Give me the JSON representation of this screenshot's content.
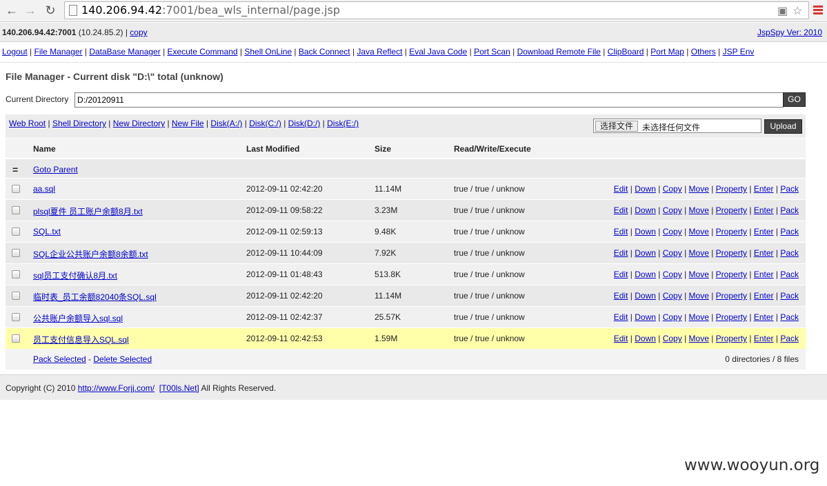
{
  "browser": {
    "url_host": "140.206.94.42",
    "url_path": ":7001/bea_wls_internal/page.jsp"
  },
  "header": {
    "host": "140.206.94.42:7001",
    "ip": " (10.24.85.2) | ",
    "copy": "copy",
    "version": "JspSpy Ver: 2010"
  },
  "nav": [
    "Logout",
    "File Manager",
    "DataBase Manager",
    "Execute Command",
    "Shell OnLine",
    "Back Connect",
    "Java Reflect",
    "Eval Java Code",
    "Port Scan",
    "Download Remote File",
    "ClipBoard",
    "Port Map",
    "Others",
    "JSP Env"
  ],
  "title": "File Manager - Current disk \"D:\\\" total (unknow)",
  "current_directory": {
    "label": "Current Directory",
    "value": "D:/20120911",
    "go": "GO"
  },
  "toolbar": {
    "links": [
      "Web Root",
      "Shell Directory",
      "New Directory",
      "New File",
      "Disk(A:/)",
      "Disk(C:/)",
      "Disk(D:/)",
      "Disk(E:/)"
    ],
    "choose_file": "选择文件",
    "no_file": "未选择任何文件",
    "upload": "Upload"
  },
  "table": {
    "headers": [
      "Name",
      "Last Modified",
      "Size",
      "Read/Write/Execute"
    ],
    "parent_icon": "=",
    "goto_parent": "Goto Parent",
    "rows": [
      {
        "name": "aa.sql",
        "modified": "2012-09-11 02:42:20",
        "size": "11.14M",
        "rwx": "true / true / unknow"
      },
      {
        "name": "plsql夏件 员工账户余额8月.txt",
        "modified": "2012-09-11 09:58:22",
        "size": "3.23M",
        "rwx": "true / true / unknow"
      },
      {
        "name": "SQL.txt",
        "modified": "2012-09-11 02:59:13",
        "size": "9.48K",
        "rwx": "true / true / unknow"
      },
      {
        "name": "SQL企业公共账户余额8余额.txt",
        "modified": "2012-09-11 10:44:09",
        "size": "7.92K",
        "rwx": "true / true / unknow"
      },
      {
        "name": "sql员工支付确认8月.txt",
        "modified": "2012-09-11 01:48:43",
        "size": "513.8K",
        "rwx": "true / true / unknow"
      },
      {
        "name": "临时表_员工余额82040条SQL.sql",
        "modified": "2012-09-11 02:42:20",
        "size": "11.14M",
        "rwx": "true / true / unknow"
      },
      {
        "name": "公共账户余额导入sql.sql",
        "modified": "2012-09-11 02:42:37",
        "size": "25.57K",
        "rwx": "true / true / unknow"
      },
      {
        "name": "员工支付信息导入SQL.sql",
        "modified": "2012-09-11 02:42:53",
        "size": "1.59M",
        "rwx": "true / true / unknow"
      }
    ],
    "actions": [
      "Edit",
      "Down",
      "Copy",
      "Move",
      "Property",
      "Enter",
      "Pack"
    ],
    "pack_selected": "Pack Selected",
    "delete_selected": "Delete Selected",
    "summary": "0 directories / 8 files"
  },
  "footer": {
    "prefix": "Copyright (C) 2010 ",
    "site": "http://www.Forjj.com/",
    "tools": "[T00ls.Net]",
    "suffix": " All Rights Reserved."
  },
  "watermark": "www.wooyun.org"
}
